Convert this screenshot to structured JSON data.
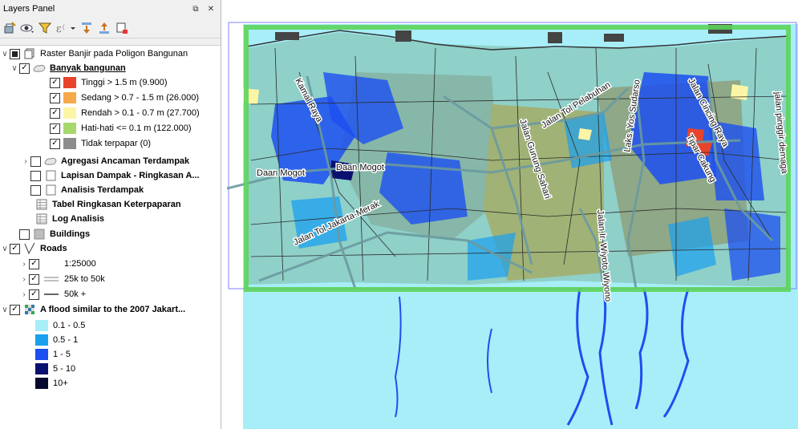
{
  "panel": {
    "title": "Layers Panel",
    "float_icon": "restore-icon",
    "close_icon": "close-icon"
  },
  "toolbar": {
    "icons": [
      "open-layer-styling-icon",
      "manage-visibility-icon",
      "filter-legend-icon",
      "filter-expression-icon",
      "expand-all-icon",
      "collapse-all-icon",
      "remove-layer-icon"
    ]
  },
  "layers": {
    "raster_group": {
      "label": "Raster Banjir pada Poligon Bangunan"
    },
    "banyak": {
      "label": "Banyak bangunan"
    },
    "classes": [
      {
        "label": "Tinggi > 1.5 m (9.900)",
        "color": "#e8442c"
      },
      {
        "label": "Sedang > 0.7 - 1.5 m (26.000)",
        "color": "#f7a84b"
      },
      {
        "label": "Rendah > 0.1 - 0.7 m (27.700)",
        "color": "#fdf5a6"
      },
      {
        "label": "Hati-hati <= 0.1 m (122.000)",
        "color": "#a6d86e"
      },
      {
        "label": "Tidak terpapar (0)",
        "color": "#8c8c8c"
      }
    ],
    "agregasi": {
      "label": "Agregasi Ancaman Terdampak"
    },
    "lapisan": {
      "label": "Lapisan Dampak - Ringkasan A..."
    },
    "analisis": {
      "label": "Analisis Terdampak"
    },
    "tabel": {
      "label": "Tabel Ringkasan Keterpaparan"
    },
    "log": {
      "label": "Log Analisis"
    },
    "buildings": {
      "label": "Buildings"
    },
    "roads": {
      "label": "Roads",
      "items": [
        {
          "label": "1:25000"
        },
        {
          "label": "25k to 50k"
        },
        {
          "label": "50k +"
        }
      ]
    },
    "flood": {
      "label": "A flood similar to the 2007 Jakart...",
      "classes": [
        {
          "label": "0.1 - 0.5",
          "color": "#a7eef9"
        },
        {
          "label": "0.5 - 1",
          "color": "#1aa0ef"
        },
        {
          "label": "1 - 5",
          "color": "#1c4ff0"
        },
        {
          "label": "5 - 10",
          "color": "#0a1070"
        },
        {
          "label": "10+",
          "color": "#05082f"
        }
      ]
    }
  },
  "map": {
    "road_labels": [
      "Kamal Raya",
      "Daan Mogot",
      "Daan Mogot",
      "Jalan Tol Jakarta-Merak",
      "Jalan Gunung Sahari",
      "Jalan Tol Pelabuhan",
      "Laks. Yos Sudarso",
      "Jalan Cincing Raya",
      "Tipar Cakung",
      "Jalan Ir. Wiyoto Wiyono",
      "jalan pinggir demaga"
    ],
    "colors": {
      "flood_light": "#a7eef9",
      "aoi_border": "#5ed35a",
      "extent_border": "#8080ff"
    }
  }
}
